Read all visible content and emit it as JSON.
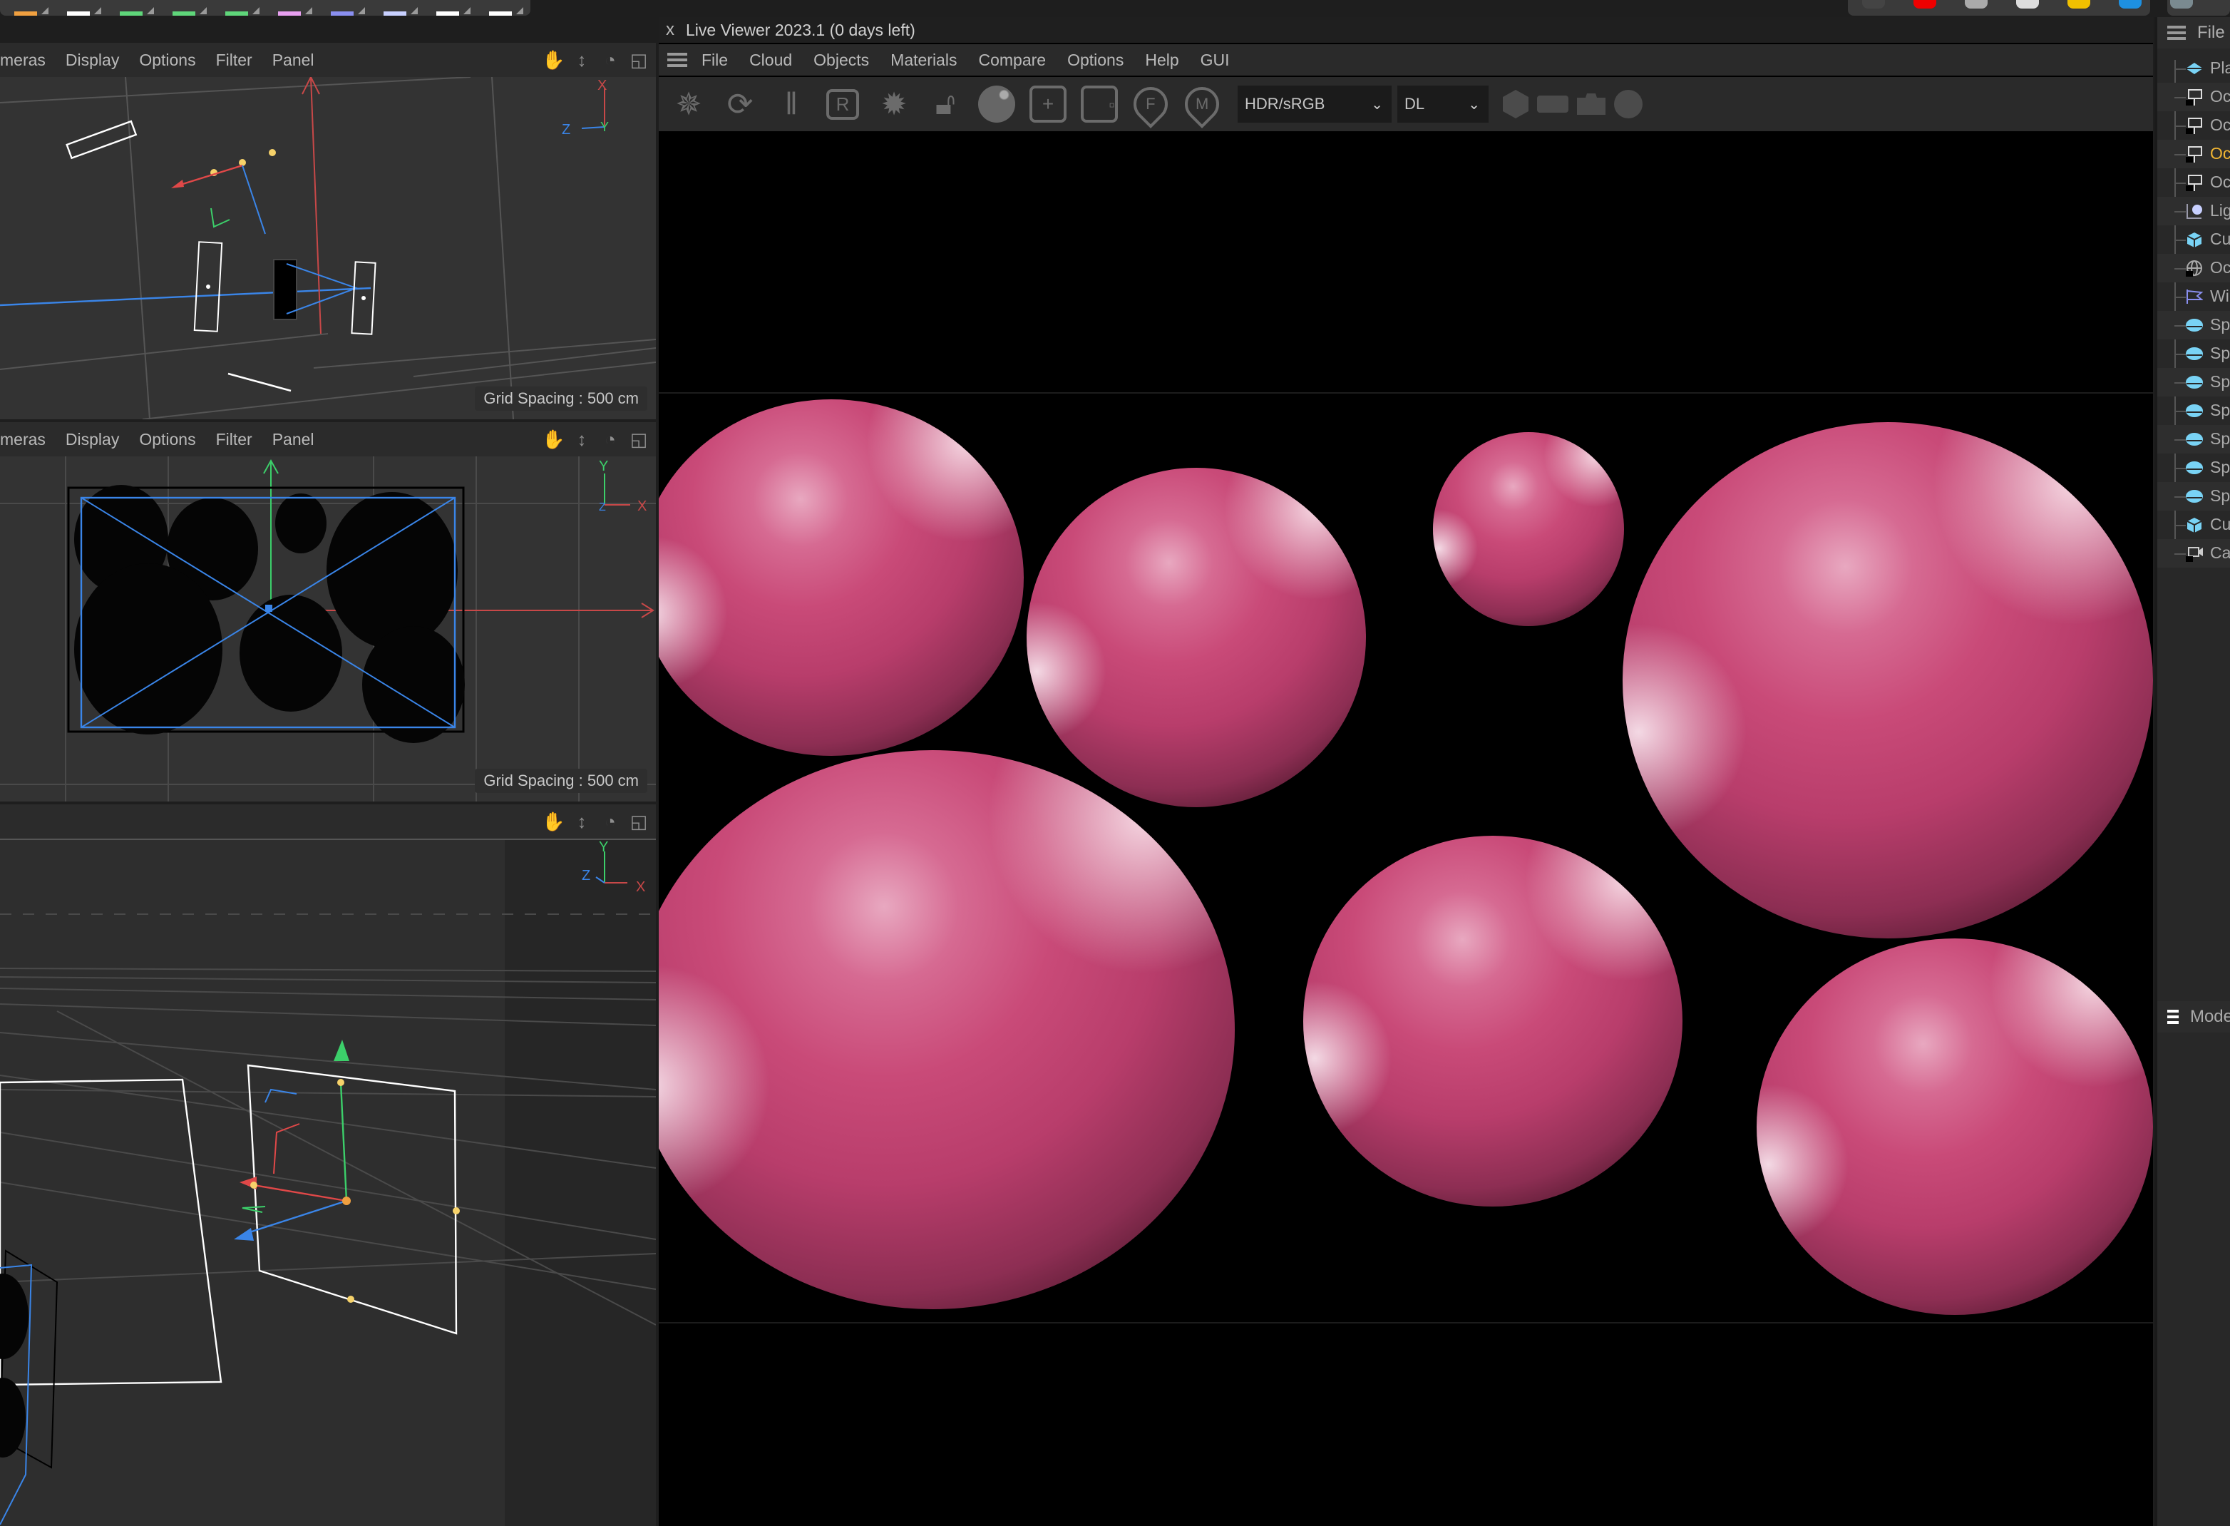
{
  "palette": {
    "left_tools": [
      "spline-arc-tool",
      "spline-points-tool",
      "cube-generator-tool",
      "cloner-tool",
      "extrude-tool",
      "deformer-tool",
      "field-tool",
      "camera-tool",
      "octane-scatter-tool",
      "octane-texture-tool"
    ],
    "right_tools": [
      "gear-tool",
      "red-light-tool",
      "area-light-tool",
      "ring-light-tool",
      "sun-light-tool",
      "daylight-tool",
      "material-preview"
    ]
  },
  "viewports": [
    {
      "name": "top-view",
      "menu": [
        "meras",
        "Display",
        "Options",
        "Filter",
        "Panel"
      ],
      "grid_spacing": "Grid Spacing : 500 cm",
      "axis": {
        "x": "X",
        "y": "Y",
        "z": "Z"
      }
    },
    {
      "name": "front-view",
      "menu": [
        "meras",
        "Display",
        "Options",
        "Filter",
        "Panel"
      ],
      "grid_spacing": "Grid Spacing : 500 cm",
      "axis": {
        "x": "X",
        "y": "Y",
        "z": "Z"
      }
    },
    {
      "name": "perspective-view",
      "menu": [],
      "axis": {
        "x": "X",
        "y": "Y",
        "z": "Z"
      }
    }
  ],
  "viewport_icons": [
    "hand-pan-icon",
    "move-vertical-icon",
    "orbit-icon",
    "maximize-icon"
  ],
  "live_viewer": {
    "close": "x",
    "title": "Live Viewer 2023.1 (0 days left)",
    "menu": [
      "File",
      "Cloud",
      "Objects",
      "Materials",
      "Compare",
      "Options",
      "Help",
      "GUI"
    ],
    "toolbar": [
      "octane-logo",
      "restart-render",
      "pause-render",
      "region-render",
      "settings-gear",
      "lock",
      "material-sphere",
      "add-region",
      "focus-region",
      "pick-focus",
      "pick-material"
    ],
    "toolbar_labels": {
      "region": "R",
      "focus": "F",
      "material": "M"
    },
    "color_space": {
      "selected": "HDR/sRGB"
    },
    "kernel": {
      "selected": "DL"
    },
    "toolbar_right": [
      "object-hexagon",
      "film-rect",
      "snapshot-camera",
      "circle-toggle"
    ],
    "sphere_color": "#c94a78"
  },
  "object_manager": {
    "header": "File",
    "items": [
      {
        "name": "Plar",
        "icon": "plane-icon"
      },
      {
        "name": "Oct",
        "icon": "octane-light-icon"
      },
      {
        "name": "Oct",
        "icon": "octane-light-icon"
      },
      {
        "name": "Oct",
        "icon": "octane-light-icon",
        "active": true
      },
      {
        "name": "Oct",
        "icon": "octane-light-icon"
      },
      {
        "name": "Ligh",
        "icon": "light-icon"
      },
      {
        "name": "Cub",
        "icon": "cube-icon"
      },
      {
        "name": "Oct",
        "icon": "octane-sky-icon"
      },
      {
        "name": "Win",
        "icon": "wind-flag-icon"
      },
      {
        "name": "Sph",
        "icon": "sphere-icon"
      },
      {
        "name": "Sph",
        "icon": "sphere-icon"
      },
      {
        "name": "Sph",
        "icon": "sphere-icon"
      },
      {
        "name": "Sph",
        "icon": "sphere-icon"
      },
      {
        "name": "Sph",
        "icon": "sphere-icon"
      },
      {
        "name": "Sph",
        "icon": "sphere-icon"
      },
      {
        "name": "Sph",
        "icon": "sphere-icon"
      },
      {
        "name": "Cub",
        "icon": "cube-icon"
      },
      {
        "name": "Can",
        "icon": "octane-camera-icon"
      }
    ],
    "mode_header": "Mode"
  },
  "colors": {
    "active_item": "#f2b632",
    "axis_x": "#e04848",
    "axis_y": "#3ccf6a",
    "axis_z": "#3a85e8"
  }
}
